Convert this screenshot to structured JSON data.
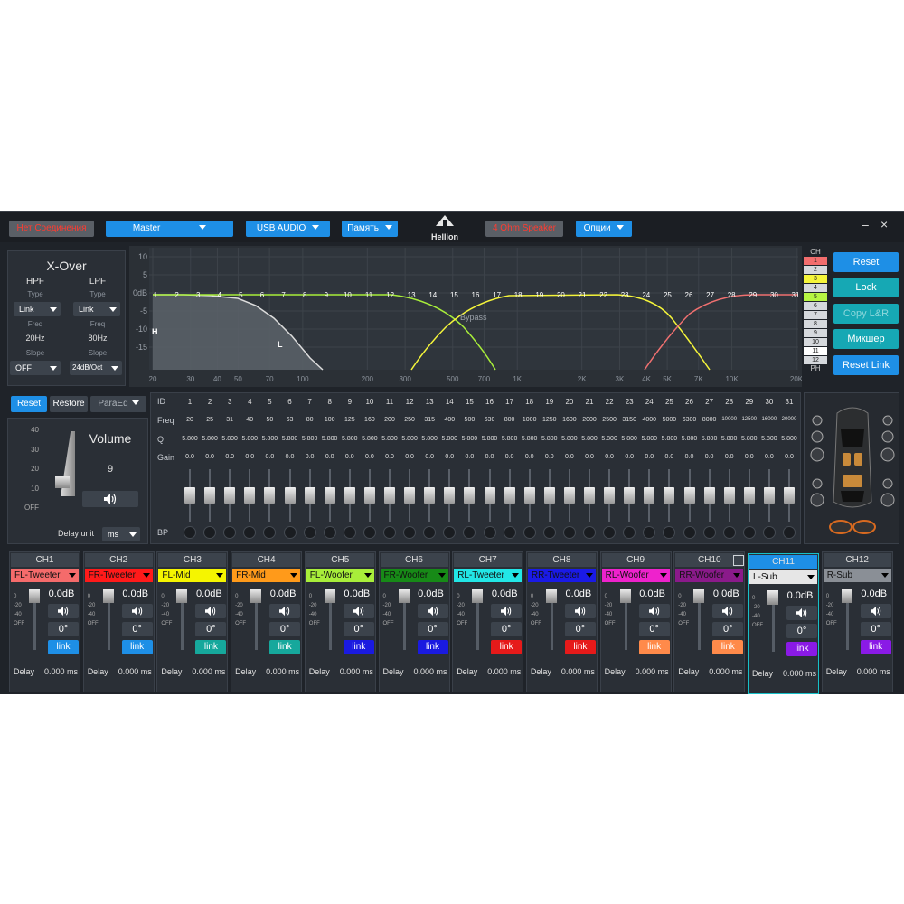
{
  "topbar": {
    "connection": "Нет Соединения",
    "source": "Master",
    "device": "USB AUDIO",
    "memory": "Память",
    "speaker": "4 Ohm Speaker",
    "options": "Опции",
    "brand": "Hellion",
    "minimize": "–",
    "close": "×"
  },
  "xover": {
    "title": "X-Over",
    "hpf": {
      "label": "HPF",
      "type_label": "Type",
      "type": "Link",
      "freq_label": "Freq",
      "freq": "20Hz",
      "slope_label": "Slope",
      "slope": "OFF"
    },
    "lpf": {
      "label": "LPF",
      "type_label": "Type",
      "type": "Link",
      "freq_label": "Freq",
      "freq": "80Hz",
      "slope_label": "Slope",
      "slope": "24dB/Oct"
    }
  },
  "graph": {
    "y_ticks": [
      "10",
      "5",
      "0dB",
      "-5",
      "-10",
      "-15"
    ],
    "x_ticks": [
      "20",
      "30",
      "40",
      "50",
      "70",
      "100",
      "200",
      "300",
      "500",
      "700",
      "1K",
      "2K",
      "3K",
      "4K",
      "5K",
      "7K",
      "10K",
      "20K"
    ],
    "bypass": "Bypass",
    "h_marker": "H",
    "l_marker": "L",
    "band_ids": [
      "1",
      "2",
      "3",
      "4",
      "5",
      "6",
      "7",
      "8",
      "9",
      "10",
      "11",
      "12",
      "13",
      "14",
      "15",
      "16",
      "17",
      "18",
      "19",
      "20",
      "21",
      "22",
      "23",
      "24",
      "25",
      "26",
      "27",
      "28",
      "29",
      "30",
      "31"
    ]
  },
  "ch_selector": {
    "title": "CH",
    "items": [
      "1",
      "2",
      "3",
      "4",
      "5",
      "6",
      "7",
      "8",
      "9",
      "10",
      "11",
      "12"
    ],
    "footer": "PH",
    "colors": [
      "#f26d6d",
      "#d5d8dc",
      "#f5f53a",
      "#d5d8dc",
      "#b6f542",
      "#d5d8dc",
      "#d5d8dc",
      "#d5d8dc",
      "#d5d8dc",
      "#d5d8dc",
      "#ffffff",
      "#d5d8dc"
    ]
  },
  "actions": {
    "reset": "Reset",
    "lock": "Lock",
    "copy": "Copy L&R",
    "mixer": "Микшер",
    "reset_link": "Reset Link"
  },
  "volume": {
    "reset": "Reset",
    "restore": "Restore",
    "mode": "ParaEq",
    "title": "Volume",
    "value": "9",
    "scale": [
      "40",
      "30",
      "20",
      "10",
      "OFF"
    ],
    "delay_unit_label": "Delay unit",
    "delay_unit": "ms",
    "level_fraction": 0.22
  },
  "eq": {
    "labels": {
      "id": "ID",
      "freq": "Freq",
      "q": "Q",
      "gain": "Gain",
      "bp": "BP"
    },
    "ids": [
      "1",
      "2",
      "3",
      "4",
      "5",
      "6",
      "7",
      "8",
      "9",
      "10",
      "11",
      "12",
      "13",
      "14",
      "15",
      "16",
      "17",
      "18",
      "19",
      "20",
      "21",
      "22",
      "23",
      "24",
      "25",
      "26",
      "27",
      "28",
      "29",
      "30",
      "31"
    ],
    "freqs": [
      "20",
      "25",
      "31",
      "40",
      "50",
      "63",
      "80",
      "100",
      "125",
      "160",
      "200",
      "250",
      "315",
      "400",
      "500",
      "630",
      "800",
      "1000",
      "1250",
      "1600",
      "2000",
      "2500",
      "3150",
      "4000",
      "5000",
      "6300",
      "8000",
      "10000",
      "12500",
      "16000",
      "20000"
    ],
    "q": "5.800",
    "gain": "0.0"
  },
  "channels": [
    {
      "ch": "CH1",
      "name": "FL-Tweeter",
      "color": "#f56b6b",
      "db": "0.0dB",
      "phase": "0°",
      "link": "link",
      "link_color": "#1e8fe6",
      "delay_label": "Delay",
      "delay": "0.000 ms"
    },
    {
      "ch": "CH2",
      "name": "FR-Tweeter",
      "color": "#ff1a1a",
      "db": "0.0dB",
      "phase": "0°",
      "link": "link",
      "link_color": "#1e8fe6",
      "delay_label": "Delay",
      "delay": "0.000 ms"
    },
    {
      "ch": "CH3",
      "name": "FL-Mid",
      "color": "#f5f500",
      "db": "0.0dB",
      "phase": "0°",
      "link": "link",
      "link_color": "#16a89c",
      "delay_label": "Delay",
      "delay": "0.000 ms"
    },
    {
      "ch": "CH4",
      "name": "FR-Mid",
      "color": "#ff9a1a",
      "db": "0.0dB",
      "phase": "0°",
      "link": "link",
      "link_color": "#16a89c",
      "delay_label": "Delay",
      "delay": "0.000 ms"
    },
    {
      "ch": "CH5",
      "name": "FL-Woofer",
      "color": "#a8ee3a",
      "db": "0.0dB",
      "phase": "0°",
      "link": "link",
      "link_color": "#1a1ae0",
      "delay_label": "Delay",
      "delay": "0.000 ms"
    },
    {
      "ch": "CH6",
      "name": "FR-Woofer",
      "color": "#178a17",
      "db": "0.0dB",
      "phase": "0°",
      "link": "link",
      "link_color": "#1a1ae0",
      "delay_label": "Delay",
      "delay": "0.000 ms"
    },
    {
      "ch": "CH7",
      "name": "RL-Tweeter",
      "color": "#22e6e6",
      "db": "0.0dB",
      "phase": "0°",
      "link": "link",
      "link_color": "#e61a1a",
      "delay_label": "Delay",
      "delay": "0.000 ms"
    },
    {
      "ch": "CH8",
      "name": "RR-Tweeter",
      "color": "#1a1ae6",
      "db": "0.0dB",
      "phase": "0°",
      "link": "link",
      "link_color": "#e61a1a",
      "delay_label": "Delay",
      "delay": "0.000 ms"
    },
    {
      "ch": "CH9",
      "name": "RL-Woofer",
      "color": "#ee22cc",
      "db": "0.0dB",
      "phase": "0°",
      "link": "link",
      "link_color": "#ff8a4a",
      "delay_label": "Delay",
      "delay": "0.000 ms"
    },
    {
      "ch": "CH10",
      "name": "RR-Woofer",
      "color": "#8a1a8a",
      "db": "0.0dB",
      "phase": "0°",
      "link": "link",
      "link_color": "#ff8a4a",
      "delay_label": "Delay",
      "delay": "0.000 ms"
    },
    {
      "ch": "CH11",
      "name": "L-Sub",
      "color": "#e6e6e6",
      "db": "0.0dB",
      "phase": "0°",
      "link": "link",
      "link_color": "#8a1ae6",
      "delay_label": "Delay",
      "delay": "0.000 ms"
    },
    {
      "ch": "CH12",
      "name": "R-Sub",
      "color": "#8a8f96",
      "db": "0.0dB",
      "phase": "0°",
      "link": "link",
      "link_color": "#8a1ae6",
      "delay_label": "Delay",
      "delay": "0.000 ms"
    }
  ],
  "channel_scale": [
    "0",
    "-20",
    "-40",
    "OFF"
  ]
}
